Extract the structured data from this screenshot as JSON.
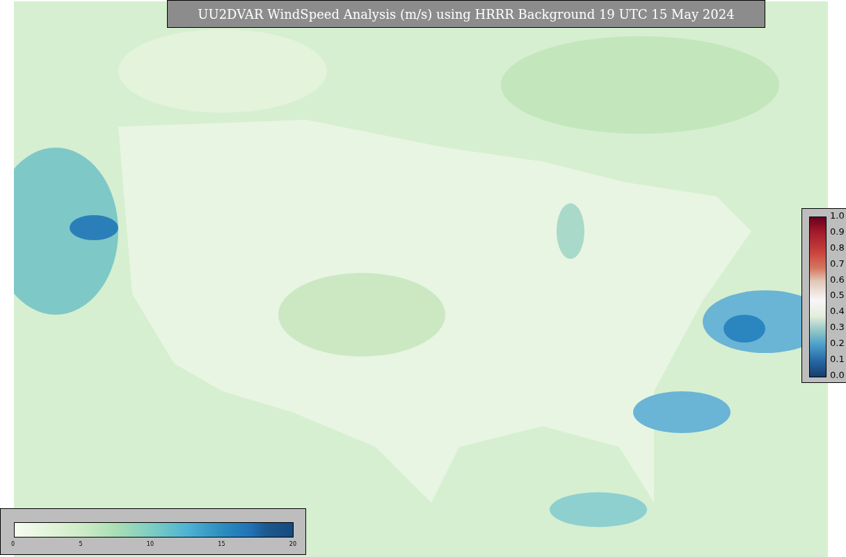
{
  "title": "UU2DVAR WindSpeed Analysis (m/s) using HRRR Background 19 UTC 15 May 2024",
  "windspeed_colorbar": {
    "ticks": [
      "0",
      "5",
      "10",
      "15",
      "20"
    ]
  },
  "ratio_colorbar": {
    "ticks": [
      "1.0",
      "0.9",
      "0.8",
      "0.7",
      "0.6",
      "0.5",
      "0.4",
      "0.3",
      "0.2",
      "0.1",
      "0.0"
    ]
  }
}
